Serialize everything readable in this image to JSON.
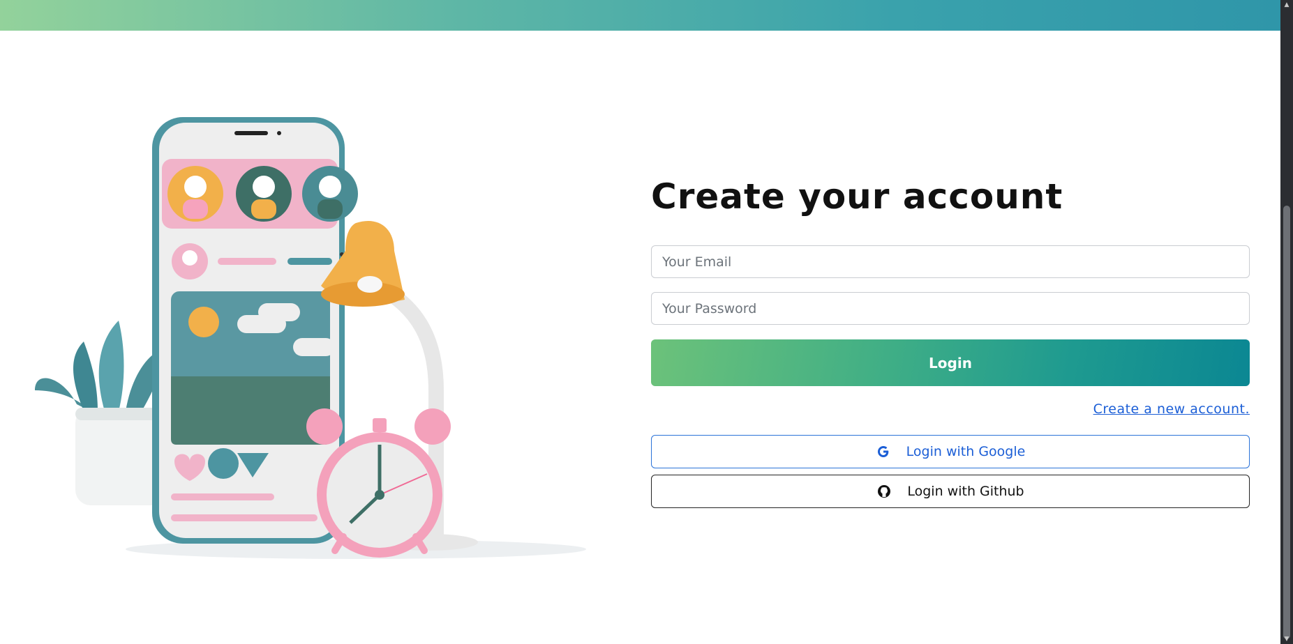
{
  "form": {
    "title": "Create your account",
    "email_placeholder": "Your Email",
    "password_placeholder": "Your Password",
    "login_label": "Login",
    "create_account_link": "Create a new account.",
    "google_label": "Login with Google",
    "github_label": "Login with Github"
  },
  "colors": {
    "accent_start": "#6cc27a",
    "accent_end": "#0b8793",
    "link": "#1b5ed6"
  },
  "icons": {
    "google": "google-icon",
    "github": "github-icon"
  }
}
